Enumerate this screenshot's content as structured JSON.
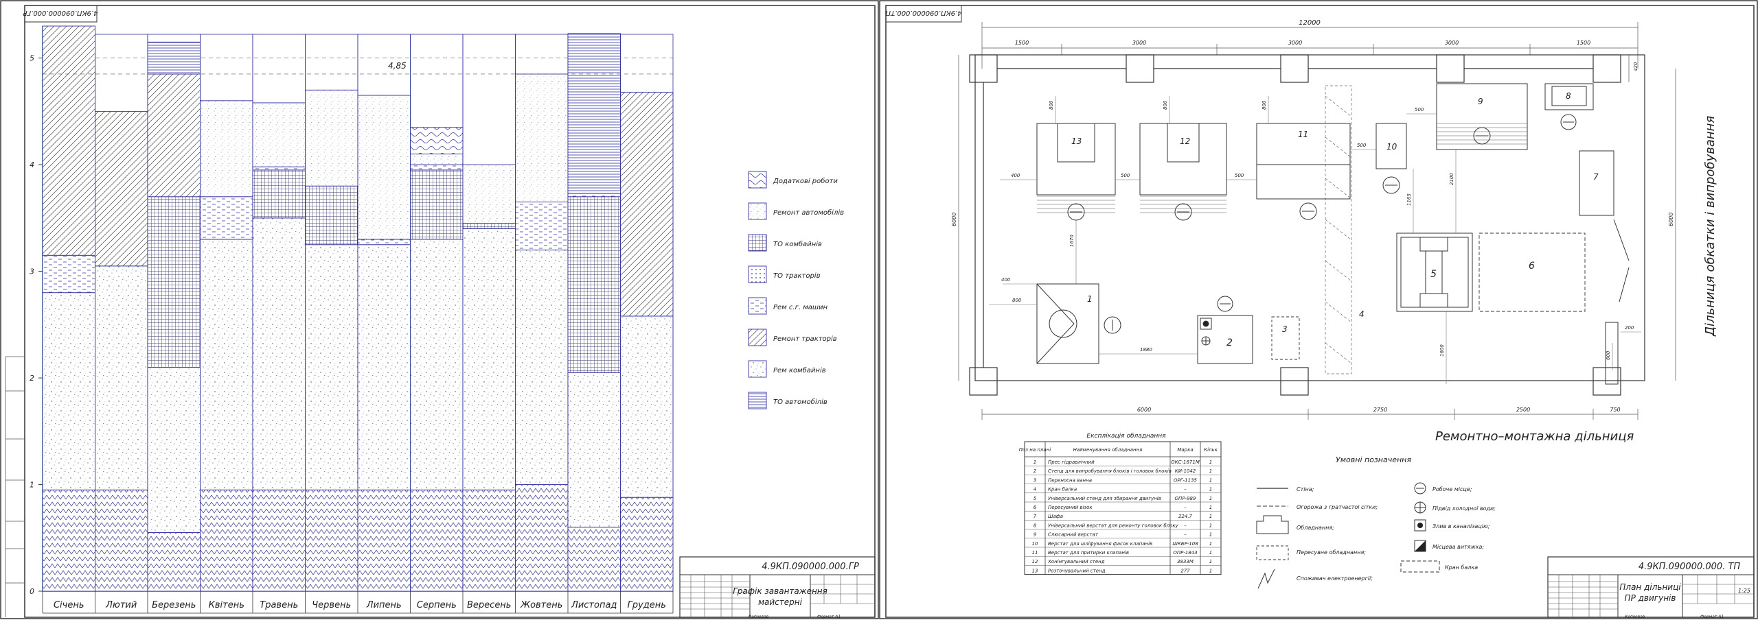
{
  "left_sheet": {
    "stamp_top": "4.9КП.090000.000.ГР",
    "title_code": "4.9КП.090000.000.ГР",
    "title_name_line1": "Графік завантаження",
    "title_name_line2": "майстерні",
    "footer_copied": "Копіював",
    "footer_format": "Формат  А1",
    "max_annotation": "4,85",
    "legend": [
      {
        "label": "Додаткові роботи",
        "pattern": "wave",
        "color": "#3030a0"
      },
      {
        "label": "Ремонт автомобілів",
        "pattern": "fine",
        "color": "#3030a0"
      },
      {
        "label": "ТО комбайнів",
        "pattern": "grid",
        "color": "#3030a0"
      },
      {
        "label": "ТО тракторів",
        "pattern": "dots",
        "color": "#3030a0"
      },
      {
        "label": "Рем с.г. машин",
        "pattern": "dash",
        "color": "#3030a0"
      },
      {
        "label": "Ремонт тракторів",
        "pattern": "hatch",
        "color": "#3030a0"
      },
      {
        "label": "Рем комбайнів",
        "pattern": "speck",
        "color": "#3030a0"
      },
      {
        "label": "ТО автомобілів",
        "pattern": "hlines",
        "color": "#3030a0"
      }
    ]
  },
  "chart_data": {
    "type": "bar",
    "stacked": true,
    "categories": [
      "Січень",
      "Лютий",
      "Березень",
      "Квітень",
      "Травень",
      "Червень",
      "Липень",
      "Серпень",
      "Вересень",
      "Жовтень",
      "Листопад",
      "Грудень"
    ],
    "y_ticks": [
      "0",
      "1",
      "2",
      "3",
      "4",
      "5"
    ],
    "ylim": [
      0,
      5.3
    ],
    "series": [
      {
        "pattern": "zigzag",
        "values": [
          0.95,
          0.95,
          0.55,
          0.95,
          0.95,
          0.95,
          0.95,
          0.95,
          0.95,
          1.0,
          0.6,
          0.88
        ]
      },
      {
        "pattern": "speck",
        "values": [
          1.85,
          2.1,
          1.55,
          2.35,
          2.55,
          2.3,
          2.3,
          2.35,
          2.45,
          2.2,
          1.45,
          1.7
        ]
      },
      {
        "pattern": "grid",
        "values": [
          0,
          0,
          1.6,
          0,
          0.45,
          0.55,
          0,
          0.65,
          0.05,
          0,
          1.65,
          0
        ]
      },
      {
        "pattern": "dash",
        "values": [
          0.35,
          0,
          0,
          0.4,
          0.03,
          0,
          0.05,
          0.05,
          0,
          0.45,
          0.03,
          0
        ]
      },
      {
        "pattern": "hatch",
        "values": [
          2.15,
          1.45,
          1.15,
          0,
          0,
          0,
          0,
          0,
          0,
          0,
          0,
          2.1
        ]
      },
      {
        "pattern": "fine",
        "values": [
          0,
          0,
          0,
          0.9,
          0.6,
          0.9,
          1.35,
          0.1,
          0.55,
          1.2,
          0,
          0
        ]
      },
      {
        "pattern": "wave",
        "values": [
          0,
          0,
          0,
          0,
          0,
          0,
          0,
          0.25,
          0,
          0,
          0,
          0
        ]
      },
      {
        "pattern": "hlines",
        "values": [
          0,
          0,
          0.3,
          0,
          0,
          0,
          0,
          0,
          0,
          0,
          1.5,
          0
        ]
      }
    ]
  },
  "right_sheet": {
    "stamp_top": "4.9КП.090000.000.ТП",
    "title_code": "4.9КП.090000.000. ТП",
    "title_name_line1": "План дільниці",
    "title_name_line2": "ПР двигунів",
    "scale": "1:25",
    "footer_copied": "Копіював",
    "footer_format": "Формат  А1",
    "overall_width": "12000",
    "top_dims": [
      "1500",
      "3000",
      "3000",
      "3000",
      "1500"
    ],
    "bottom_dims": [
      "6000",
      "2750",
      "2500",
      "750"
    ],
    "side_dims": [
      "6000",
      "6000",
      "420"
    ],
    "inner_dims": [
      "800",
      "800",
      "800",
      "400",
      "500",
      "500",
      "500",
      "500",
      "1670",
      "2100",
      "1165",
      "400",
      "800",
      "1880",
      "1600",
      "200",
      "600"
    ],
    "station_numbers": [
      "1",
      "2",
      "3",
      "4",
      "5",
      "6",
      "7",
      "8",
      "9",
      "10",
      "11",
      "12",
      "13"
    ],
    "right_area_label": "Дільниця обкатки і випробування",
    "bottom_area_label": "Ремонтно–монтажна дільниця",
    "equipment_table": {
      "title": "Експлікація обладнання",
      "headers": [
        "Поз на плані",
        "Найменування обладнання",
        "Марка",
        "Кільк"
      ],
      "rows": [
        [
          "1",
          "Прес гідравлічний",
          "ОКС-1671М",
          "1"
        ],
        [
          "2",
          "Стенд для випробування блоків і головок блоків",
          "КИ-1042",
          "1"
        ],
        [
          "3",
          "Переносна ванна",
          "ОРГ-1135",
          "1"
        ],
        [
          "4",
          "Кран балка",
          "–",
          "1"
        ],
        [
          "5",
          "Універсальний стенд для збирання двигунів",
          "ОПР-989",
          "1"
        ],
        [
          "6",
          "Пересувний візок",
          "–",
          "1"
        ],
        [
          "7",
          "Шафа",
          "224.7",
          "1"
        ],
        [
          "8",
          "Універсальний верстат для ремонту головок блоку",
          "–",
          "1"
        ],
        [
          "9",
          "Слюсарний верстат",
          "–",
          "1"
        ],
        [
          "10",
          "Верстат для шліфування фасок клапанів",
          "ШКБР-108",
          "1"
        ],
        [
          "11",
          "Верстат для притирки клапанів",
          "ОПР-1843",
          "1"
        ],
        [
          "12",
          "Хонінгувальний стенд",
          "3833М",
          "1"
        ],
        [
          "13",
          "Розточувальний стенд",
          "277",
          "1"
        ]
      ]
    },
    "symbols": {
      "title": "Умовні позначення",
      "left": [
        "Стіна;",
        "Огорожа з гратчастої сітки;",
        "Обладнання;",
        "Пересувне обладнання;",
        "Споживач електроенергії;"
      ],
      "right": [
        "Робоче місце;",
        "Підвід холодної води;",
        "Злив в каналізацію;",
        "Місцева витяжка;",
        "Кран балка"
      ]
    }
  }
}
